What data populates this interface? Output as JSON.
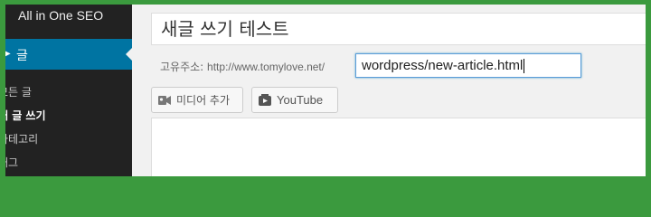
{
  "sidebar": {
    "plugin_label": "All in One SEO",
    "active_menu": "글",
    "submenu": [
      {
        "label": "모든 글"
      },
      {
        "label": "새 글 쓰기",
        "current": true
      },
      {
        "label": "카테고리"
      },
      {
        "label": "태그"
      }
    ]
  },
  "editor": {
    "title_value": "새글 쓰기 테스트",
    "permalink_label": "고유주소:",
    "permalink_base": "http://www.tomylove.net/",
    "slug_value": "wordpress/new-article.html",
    "media_button": "미디어 추가",
    "youtube_button": "YouTube"
  },
  "colors": {
    "frame_green": "#3b9a3e",
    "sidebar_bg": "#222222",
    "active_menu_bg": "#0074a2",
    "focus_blue": "#5b9dd9"
  }
}
